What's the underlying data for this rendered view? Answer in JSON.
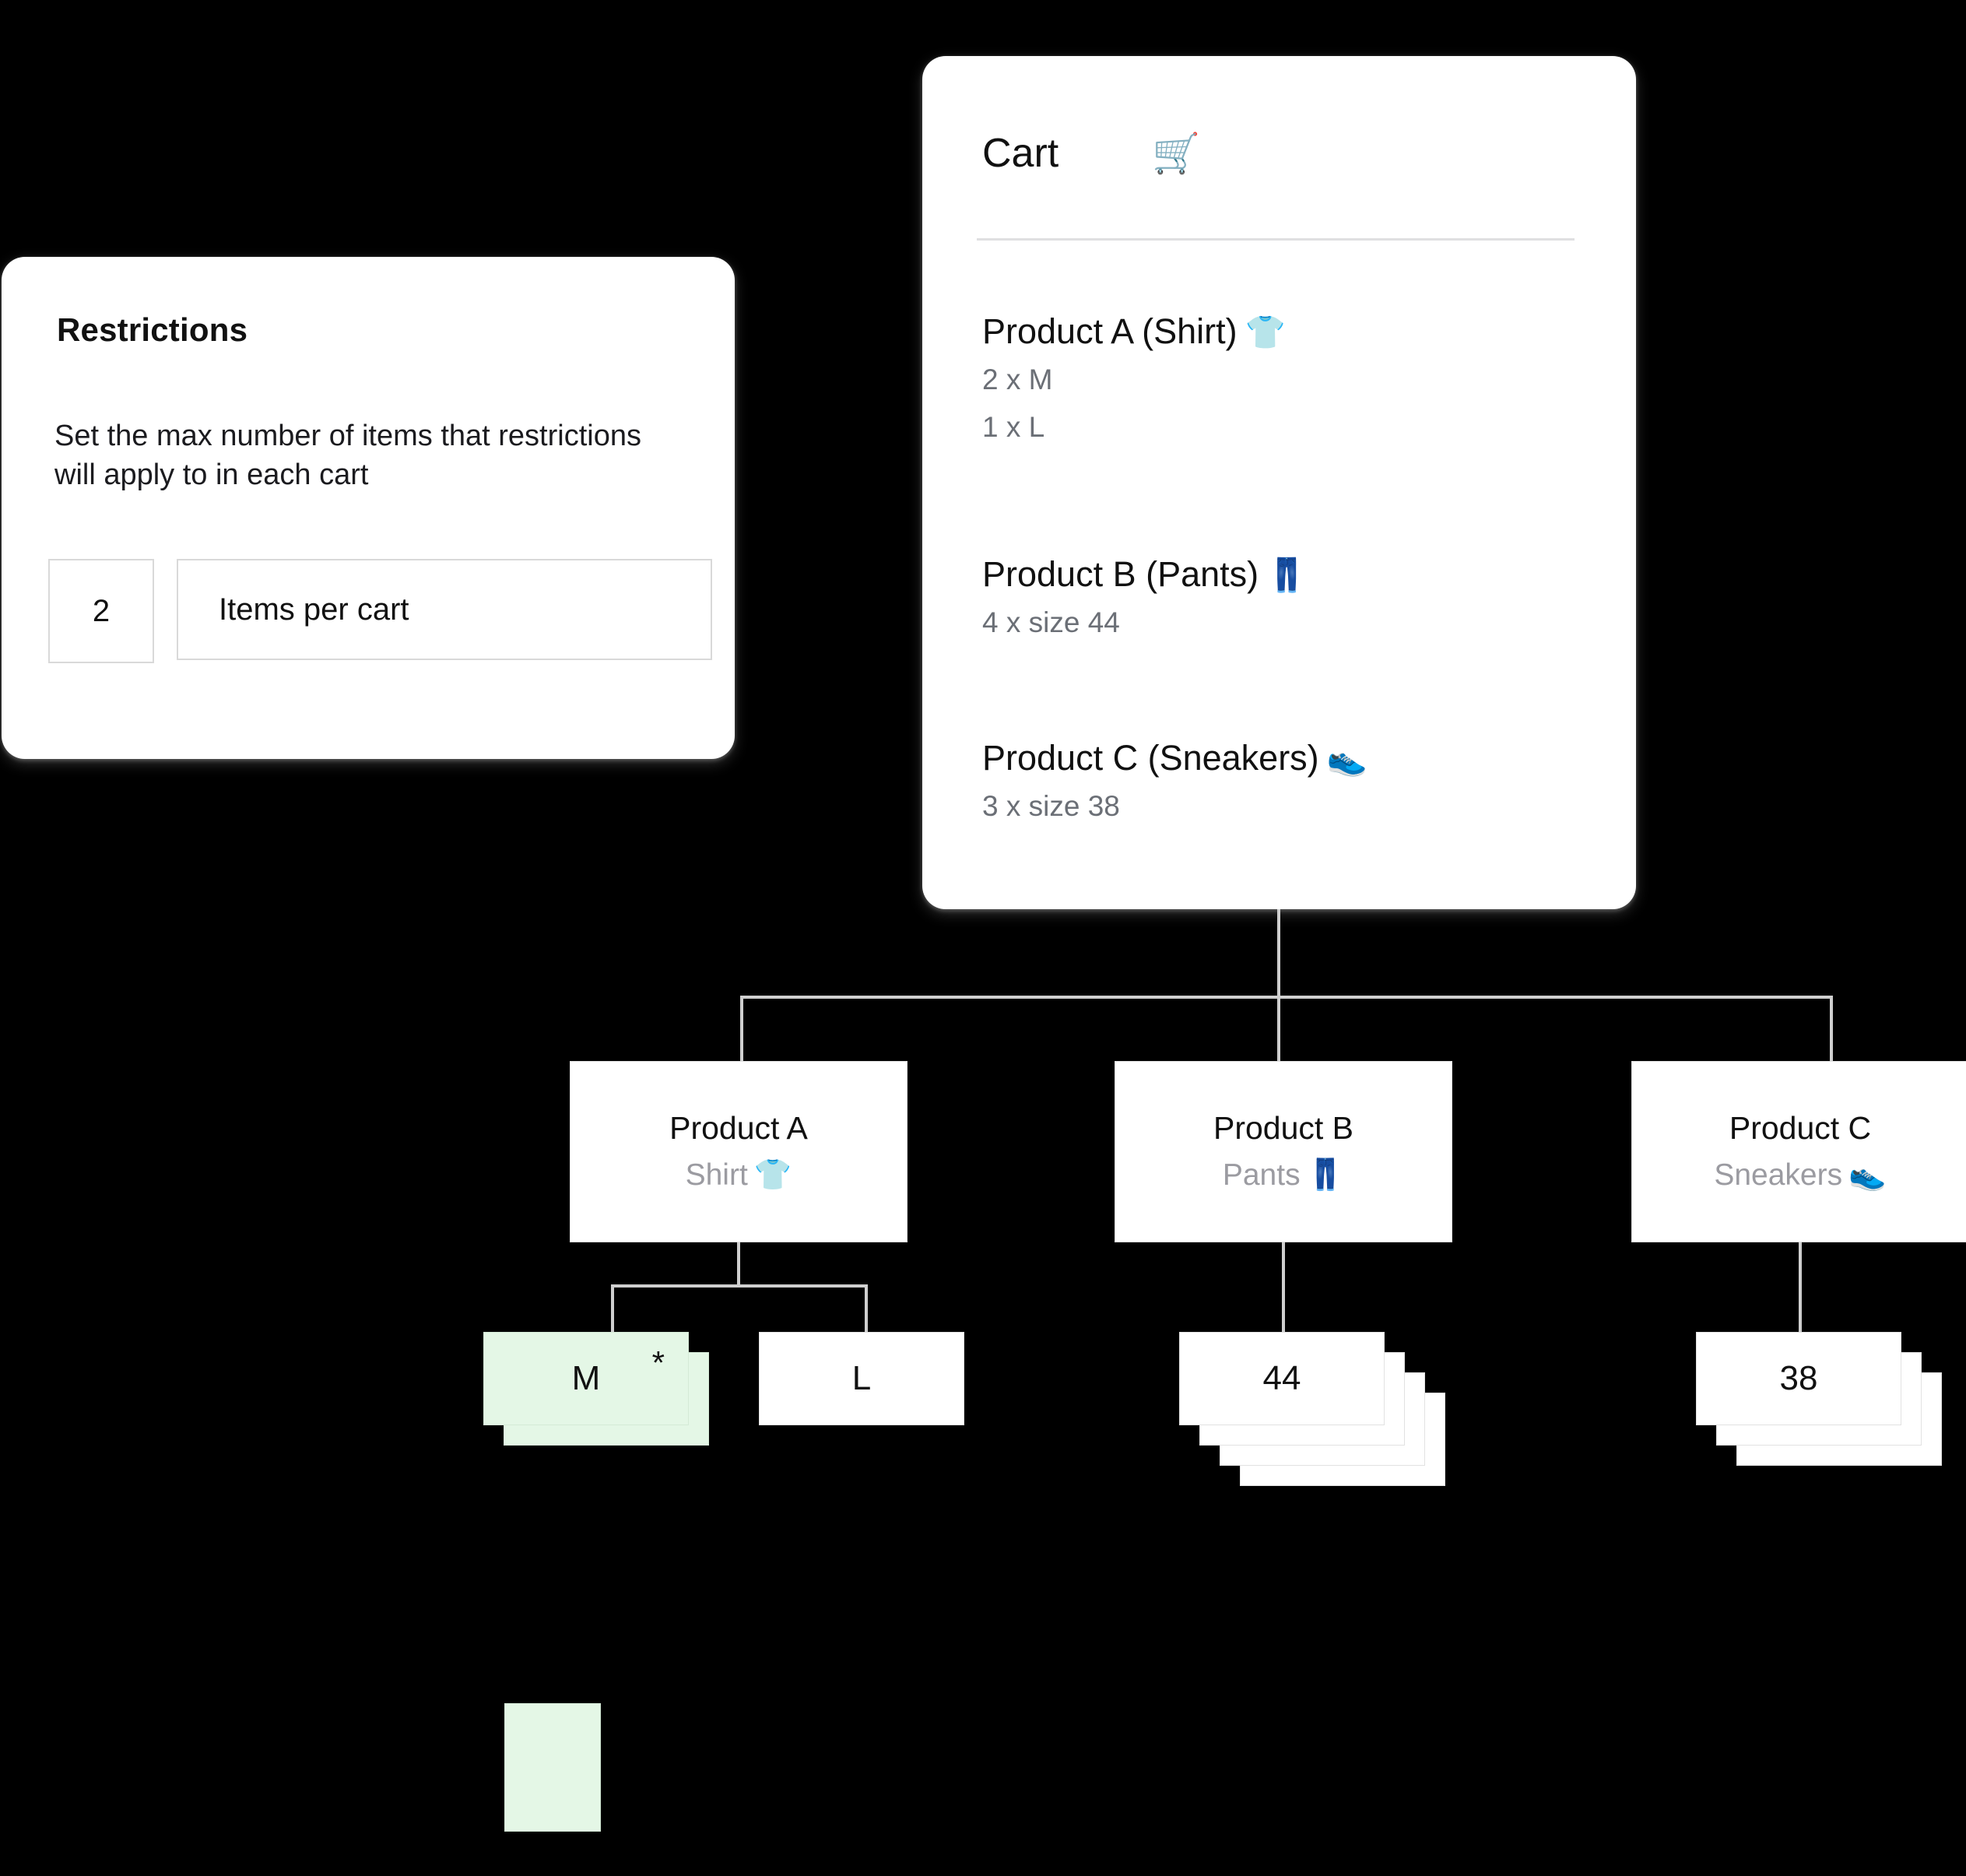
{
  "restrictions": {
    "title": "Restrictions",
    "description": "Set the max number of items  that restrictions will apply to in each cart",
    "quantity_value": "2",
    "quantity_label": "Items per cart"
  },
  "cart": {
    "title": "Cart",
    "icon": "🛒",
    "items": [
      {
        "title": "Product A (Shirt)",
        "emoji": "👕",
        "lines": [
          "2 x M",
          "1 x L"
        ]
      },
      {
        "title": "Product B (Pants)",
        "emoji": "👖",
        "lines": [
          "4 x size 44"
        ]
      },
      {
        "title": "Product C (Sneakers)",
        "emoji": "👟",
        "lines": [
          "3 x size 38"
        ]
      }
    ]
  },
  "tree": {
    "products": [
      {
        "title": "Product A",
        "subtitle": "Shirt",
        "emoji": "👕"
      },
      {
        "title": "Product B",
        "subtitle": "Pants",
        "emoji": "👖"
      },
      {
        "title": "Product C",
        "subtitle": "Sneakers",
        "emoji": "👟"
      }
    ],
    "variants": [
      {
        "label": "M",
        "count": 2,
        "highlighted": true,
        "marker": "*"
      },
      {
        "label": "L",
        "count": 1,
        "highlighted": false,
        "marker": ""
      },
      {
        "label": "44",
        "count": 4,
        "highlighted": false,
        "marker": ""
      },
      {
        "label": "38",
        "count": 3,
        "highlighted": false,
        "marker": ""
      }
    ]
  },
  "legend": {
    "swatch_color": "#e4f7e6"
  },
  "colors": {
    "background": "#000000",
    "card_background": "#ffffff",
    "highlight_green": "#e4f7e6",
    "connector_gray": "#cfcfcf",
    "muted_text": "#9b9ba1",
    "cart_sub_text": "#6b6f76",
    "border_gray": "#d9d9d9"
  }
}
